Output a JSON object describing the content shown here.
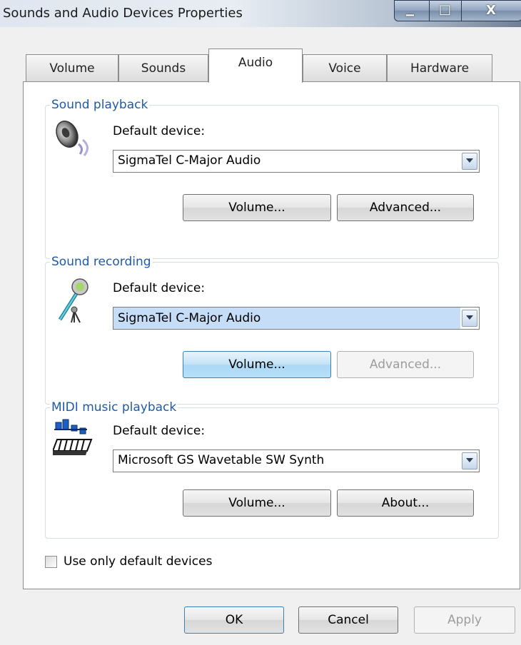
{
  "window": {
    "title": "Sounds and Audio Devices Properties",
    "controls": {
      "minimize_glyph": "▁",
      "maximize_glyph": "□",
      "close_glyph": "X"
    }
  },
  "tabs": [
    {
      "label": "Volume",
      "active": false
    },
    {
      "label": "Sounds",
      "active": false
    },
    {
      "label": "Audio",
      "active": true
    },
    {
      "label": "Voice",
      "active": false
    },
    {
      "label": "Hardware",
      "active": false
    }
  ],
  "playback": {
    "group_title": "Sound playback",
    "icon": "speaker-icon",
    "default_device_label": "Default device:",
    "device_value": "SigmaTel C-Major Audio",
    "volume_button": "Volume...",
    "advanced_button": "Advanced..."
  },
  "recording": {
    "group_title": "Sound recording",
    "icon": "microphone-icon",
    "default_device_label": "Default device:",
    "device_value": "SigmaTel C-Major Audio",
    "volume_button": "Volume...",
    "advanced_button": "Advanced..."
  },
  "midi": {
    "group_title": "MIDI music playback",
    "icon": "midi-keyboard-icon",
    "default_device_label": "Default device:",
    "device_value": "Microsoft GS Wavetable SW Synth",
    "volume_button": "Volume...",
    "about_button": "About..."
  },
  "use_default_only": {
    "label": "Use only default devices",
    "checked": false
  },
  "footer": {
    "ok": "OK",
    "cancel": "Cancel",
    "apply": "Apply"
  },
  "colors": {
    "group_title": "#1e5aa8",
    "selection": "#c6ddf7",
    "focused_button": "#a9d7f5"
  }
}
